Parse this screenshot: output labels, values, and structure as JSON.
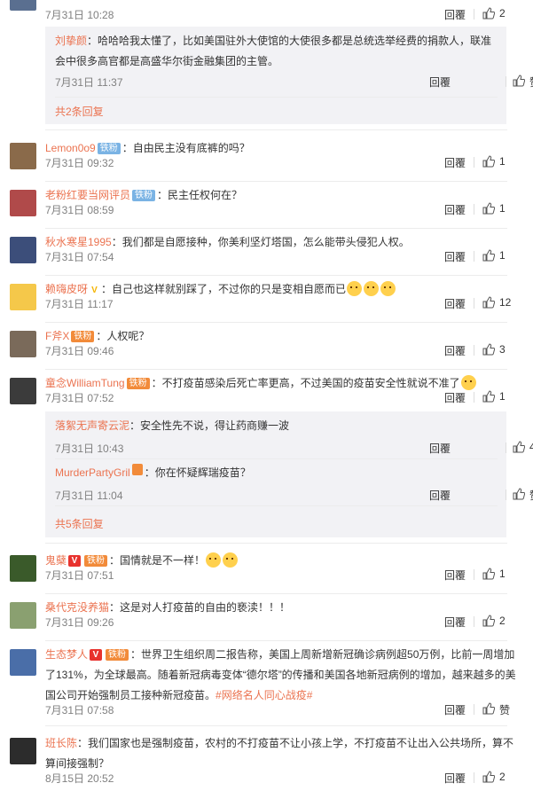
{
  "top": {
    "time": "7月31日 10:28",
    "reply": "回覆",
    "likes": "2"
  },
  "threads": [
    {
      "subreplies": [
        {
          "name": "刘挚颜",
          "text": "：哈哈哈我太懂了，比如美国驻外大使馆的大使很多都是总统选举经费的捐款人，联准会中很多高官都是高盛华尔街金融集团的主管。",
          "time": "7月31日 11:37",
          "reply": "回覆",
          "likes": "赞"
        }
      ],
      "more": "共2条回复"
    }
  ],
  "comments": [
    {
      "name": "Lemon0o9",
      "badge": "铁粉",
      "text": "：自由民主没有底裤的吗？",
      "time": "7月31日 09:32",
      "reply": "回覆",
      "likes": "1"
    },
    {
      "name": "老粉红要当网评员",
      "badge": "铁粉",
      "text": "：民主任权何在？",
      "time": "7月31日 08:59",
      "reply": "回覆",
      "likes": "1"
    },
    {
      "name": "秋水寒星1995",
      "text": "：我们都是自愿接种，你美利坚灯塔国，怎么能带头侵犯人权。",
      "time": "7月31日 07:54",
      "reply": "回覆",
      "likes": "1"
    },
    {
      "name": "赖嗨皮呀",
      "text": "：自己也这样就别踩了，不过你的只是变相自愿而已",
      "time": "7月31日 11:17",
      "reply": "回覆",
      "likes": "12"
    },
    {
      "name": "F斧X",
      "badge": "铁粉",
      "text": "：人权呢？",
      "time": "7月31日 09:46",
      "reply": "回覆",
      "likes": "3"
    },
    {
      "name": "童念WilliamTung",
      "badge": "铁粉",
      "text": "：不打疫苗感染后死亡率更高，不过美国的疫苗安全性就说不准了",
      "time": "7月31日 07:52",
      "reply": "回覆",
      "likes": "1"
    }
  ],
  "sub2": [
    {
      "name": "落絮无声寄云泥",
      "text": "：安全性先不说，得让药商赚一波",
      "time": "7月31日 10:43",
      "reply": "回覆",
      "likes": "4"
    },
    {
      "name": "MurderPartyGril",
      "text": "：你在怀疑辉瑞疫苗？",
      "time": "7月31日 11:04",
      "reply": "回覆",
      "likes": "赞"
    }
  ],
  "more2": "共5条回复",
  "comments2": [
    {
      "name": "鬼蘖",
      "badge": "铁粉",
      "text": "：国情就是不一样！",
      "time": "7月31日 07:51",
      "reply": "回覆",
      "likes": "1"
    },
    {
      "name": "桑代克没养猫",
      "text": "：这是对人打疫苗的自由的亵渎！！！",
      "time": "7月31日 09:26",
      "reply": "回覆",
      "likes": "2"
    },
    {
      "name": "生态梦人",
      "badge": "铁粉",
      "text": "：世界卫生组织周二报告称，美国上周新增新冠确诊病例超50万例，比前一周增加了131%，为全球最高。随着新冠病毒变体“德尔塔”的传播和美国各地新冠病例的增加，越来越多的美国公司开始强制员工接种新冠疫苗。",
      "hashtag": "#网络名人同心战疫#",
      "time": "7月31日 07:58",
      "reply": "回覆",
      "likes": "赞"
    },
    {
      "name": "班长陈",
      "text": "：我们国家也是强制疫苗，农村的不打疫苗不让小孩上学，不打疫苗不让出入公共场所，算不算间接强制？",
      "time": "8月15日 20:52",
      "reply": "回覆",
      "likes": "2"
    }
  ],
  "colors": {
    "name": "#eb7350",
    "time": "#808080",
    "sub_bg": "#f2f2f5"
  }
}
